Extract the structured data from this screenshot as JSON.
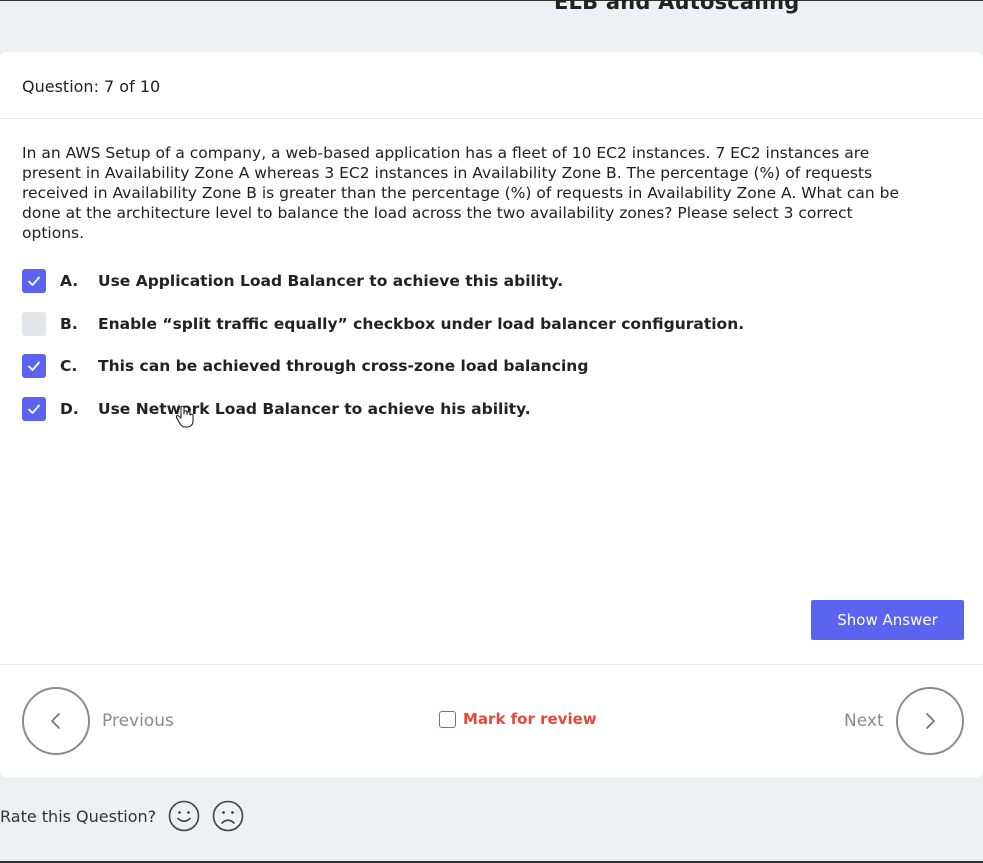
{
  "header": {
    "title": "ELB and Autoscaling"
  },
  "question": {
    "counter": "Question: 7 of 10",
    "text": "In an AWS Setup of a company, a web-based application has a fleet of 10 EC2 instances. 7 EC2 instances are present in Availability Zone A whereas 3 EC2 instances in Availability Zone B. The percentage (%) of requests received in Availability Zone B is greater than the percentage (%) of requests in Availability Zone A. What can be done at the architecture level to balance the load across the two availability zones? Please select 3 correct options."
  },
  "options": [
    {
      "letter": "A.",
      "text": "Use Application Load Balancer to achieve this ability.",
      "checked": true
    },
    {
      "letter": "B.",
      "text": "Enable “split traffic equally” checkbox under load balancer configuration.",
      "checked": false
    },
    {
      "letter": "C.",
      "text": "This can be achieved through cross-zone load balancing",
      "checked": true
    },
    {
      "letter": "D.",
      "text": "Use Network Load Balancer to achieve his ability.",
      "checked": true
    }
  ],
  "actions": {
    "show_answer": "Show Answer"
  },
  "navigation": {
    "previous": "Previous",
    "next": "Next",
    "mark_for_review": "Mark for review"
  },
  "rating": {
    "label": "Rate this Question?"
  },
  "colors": {
    "accent": "#5b63f0",
    "review": "#e44a3b"
  },
  "icons": [
    "check-icon",
    "chevron-left-icon",
    "chevron-right-icon",
    "smile-icon",
    "frown-icon",
    "hand-cursor-icon"
  ]
}
